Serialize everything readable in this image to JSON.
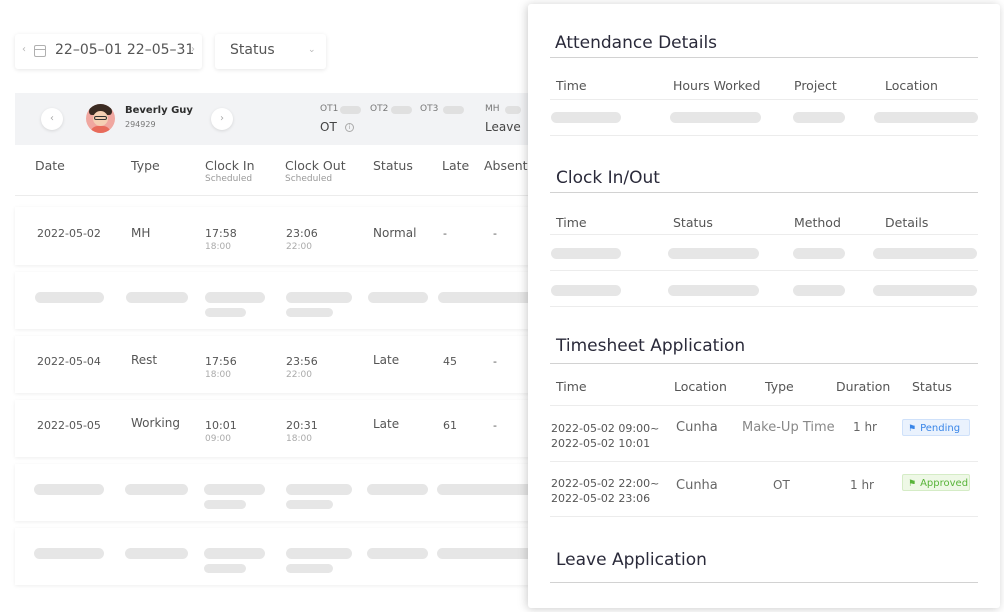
{
  "toolbar": {
    "date_range": "22–05–01 22–05–31",
    "status_select": "Status"
  },
  "employee": {
    "name": "Beverly Guy",
    "id": "294929",
    "labels": {
      "ot1": "OT1",
      "ot2": "OT2",
      "ot3": "OT3",
      "mh": "MH",
      "ot": "OT",
      "leave": "Leave"
    }
  },
  "table": {
    "headers": {
      "date": "Date",
      "type": "Type",
      "clock_in": "Clock In",
      "clock_in_sub": "Scheduled",
      "clock_out": "Clock Out",
      "clock_out_sub": "Scheduled",
      "status": "Status",
      "late": "Late",
      "absent": "Absent"
    },
    "rows": [
      {
        "date": "2022-05-02",
        "type": "MH",
        "clock_in": "17:58",
        "clock_in_sched": "18:00",
        "clock_out": "23:06",
        "clock_out_sched": "22:00",
        "status": "Normal",
        "late": "-",
        "absent": "-"
      },
      {
        "date": "2022-05-04",
        "type": "Rest",
        "clock_in": "17:56",
        "clock_in_sched": "18:00",
        "clock_out": "23:56",
        "clock_out_sched": "22:00",
        "status": "Late",
        "late": "45",
        "absent": "-"
      },
      {
        "date": "2022-05-05",
        "type": "Working",
        "clock_in": "10:01",
        "clock_in_sched": "09:00",
        "clock_out": "20:31",
        "clock_out_sched": "18:00",
        "status": "Late",
        "late": "61",
        "absent": "-"
      }
    ]
  },
  "panel": {
    "attendance": {
      "title": "Attendance Details",
      "headers": {
        "time": "Time",
        "hours": "Hours Worked",
        "project": "Project",
        "location": "Location"
      }
    },
    "clock": {
      "title": "Clock In/Out",
      "headers": {
        "time": "Time",
        "status": "Status",
        "method": "Method",
        "details": "Details"
      }
    },
    "timesheet": {
      "title": "Timesheet Application",
      "headers": {
        "time": "Time",
        "location": "Location",
        "type": "Type",
        "duration": "Duration",
        "status": "Status"
      },
      "rows": [
        {
          "time_start": "2022-05-02 09:00~",
          "time_end": "2022-05-02 10:01",
          "location": "Cunha",
          "type": "Make-Up Time",
          "duration": "1 hr",
          "status": "Pending",
          "status_color": "#3a86e8"
        },
        {
          "time_start": "2022-05-02 22:00~",
          "time_end": "2022-05-02 23:06",
          "location": "Cunha",
          "type": "OT",
          "duration": "1 hr",
          "status": "Approved",
          "status_color": "#59b43a"
        }
      ]
    },
    "leave": {
      "title": "Leave Application"
    }
  }
}
